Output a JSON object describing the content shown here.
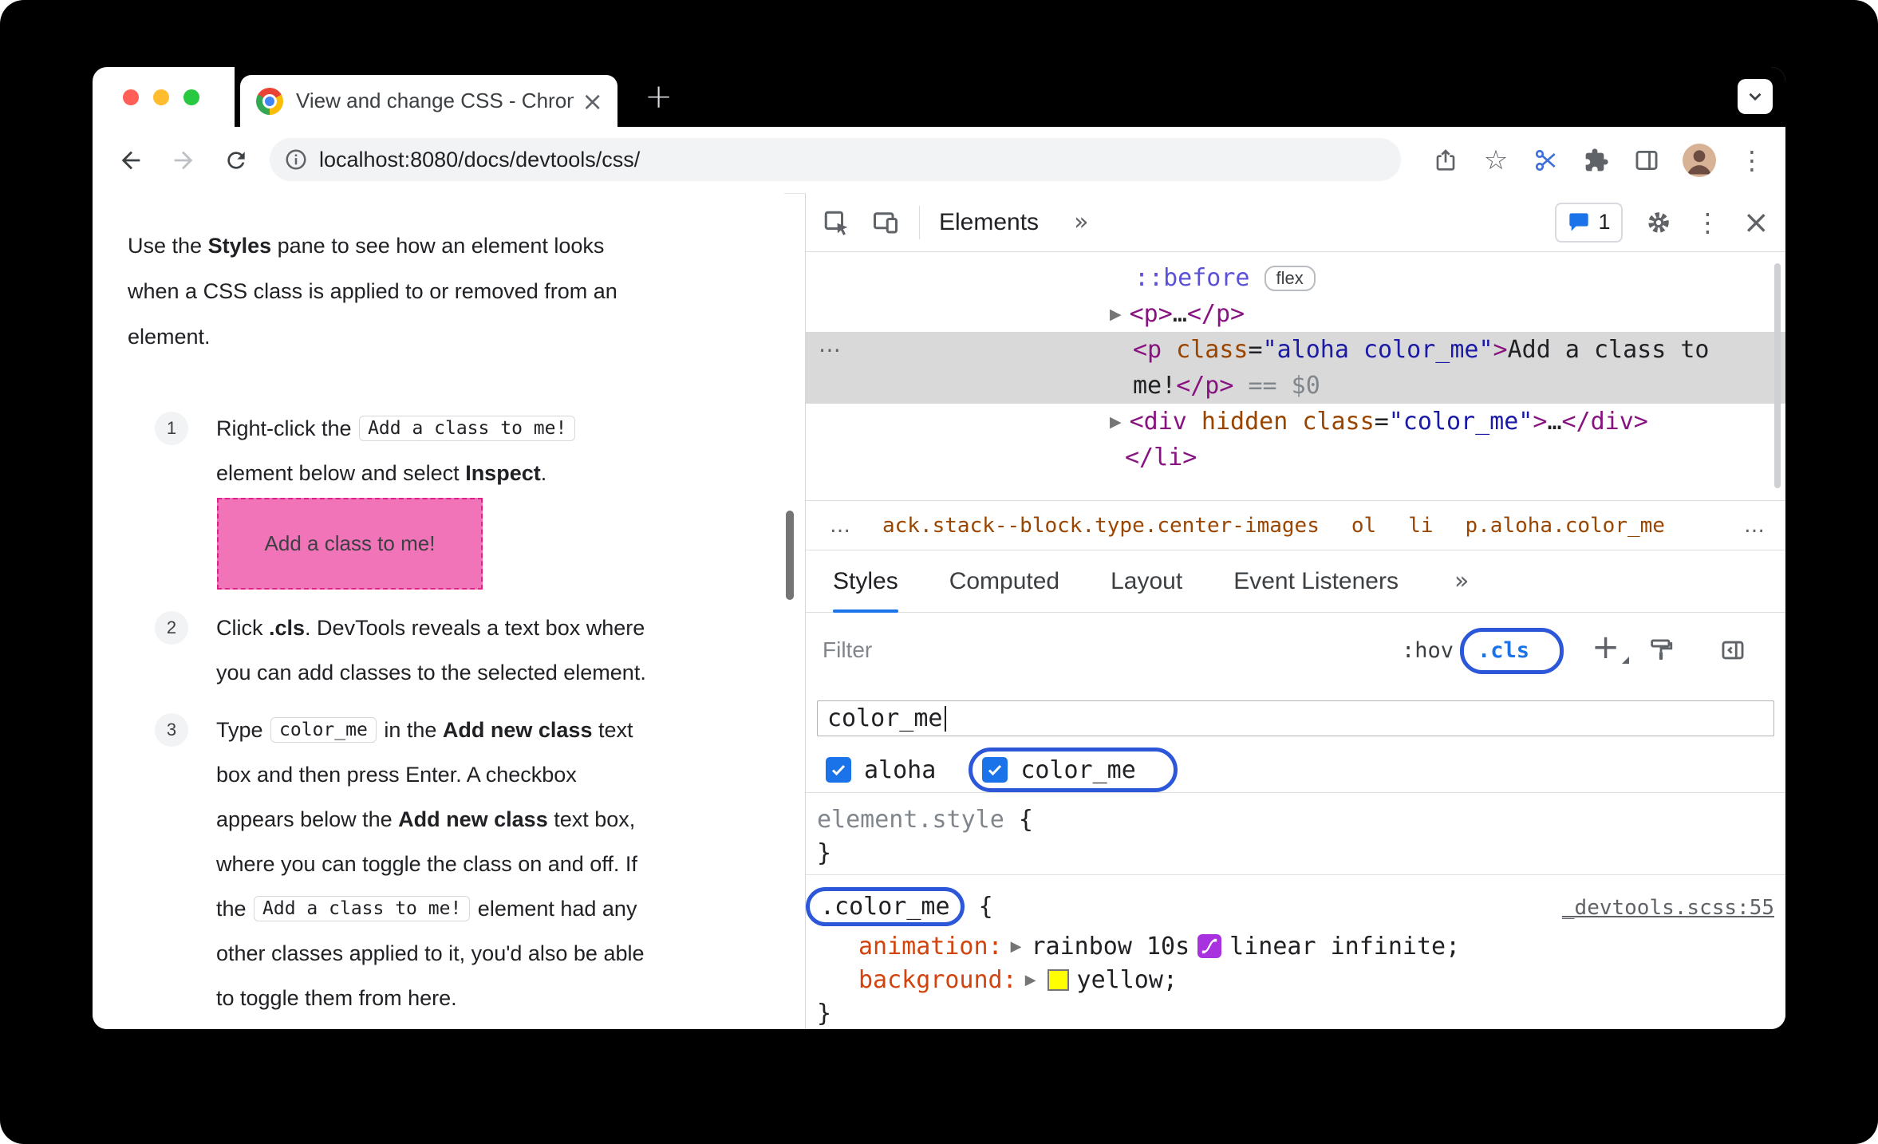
{
  "icons": {
    "star": "☆",
    "overflow": "⋮",
    "close": "×",
    "tab_close": "×",
    "new_tab": "+",
    "more": "»",
    "dom_arrow": "▶",
    "row_menu": "⋯",
    "ellipsis": "…",
    "plus": "+"
  },
  "window": {
    "tab_title": "View and change CSS - Chrom",
    "url": "localhost:8080/docs/devtools/css/"
  },
  "doc": {
    "intro_lines": [
      [
        [
          "t",
          "Use the "
        ],
        [
          "b",
          "Styles"
        ],
        [
          "t",
          " pane to see how an element looks"
        ]
      ],
      [
        [
          "t",
          "when a CSS class is applied to or removed from an"
        ]
      ],
      [
        [
          "t",
          "element."
        ]
      ]
    ],
    "steps": [
      {
        "num": "1",
        "lines": [
          [
            [
              "t",
              "Right-click the "
            ],
            [
              "c",
              "Add a class to me!"
            ]
          ],
          [
            [
              "t",
              "element below and select "
            ],
            [
              "b",
              "Inspect"
            ],
            [
              "t",
              "."
            ]
          ]
        ]
      },
      {
        "num": "2",
        "lines": [
          [
            [
              "t",
              "Click "
            ],
            [
              "b",
              ".cls"
            ],
            [
              "t",
              ". DevTools reveals a text box where"
            ]
          ],
          [
            [
              "t",
              "you can add classes to the selected element."
            ]
          ]
        ]
      },
      {
        "num": "3",
        "lines": [
          [
            [
              "t",
              "Type "
            ],
            [
              "c",
              "color_me"
            ],
            [
              "t",
              " in the "
            ],
            [
              "b",
              "Add new class"
            ],
            [
              "t",
              " text"
            ]
          ],
          [
            [
              "t",
              "box and then press Enter. A checkbox"
            ]
          ],
          [
            [
              "t",
              "appears below the "
            ],
            [
              "b",
              "Add new class"
            ],
            [
              "t",
              " text box,"
            ]
          ],
          [
            [
              "t",
              "where you can toggle the class on and off. If"
            ]
          ],
          [
            [
              "t",
              "the "
            ],
            [
              "c",
              "Add a class to me!"
            ],
            [
              "t",
              " element had any"
            ]
          ],
          [
            [
              "t",
              "other classes applied to it, you'd also be able"
            ]
          ],
          [
            [
              "t",
              "to toggle them from here."
            ]
          ]
        ]
      }
    ],
    "demo_label": "Add a class to me!"
  },
  "devtools": {
    "panel_tab": "Elements",
    "message_count": "1",
    "dom": {
      "pseudo": "::before",
      "pseudo_badge": "flex",
      "p_collapsed": [
        [
          "tag",
          "<p>"
        ],
        [
          "text",
          "…"
        ],
        [
          "tag",
          "</p>"
        ]
      ],
      "selected_line1": [
        [
          "tag",
          "<p"
        ],
        [
          "attr",
          " class"
        ],
        [
          "eq",
          "="
        ],
        [
          "val",
          "\"aloha color_me\""
        ],
        [
          "tag",
          ">"
        ],
        [
          "text",
          "Add a class to"
        ]
      ],
      "selected_line2": [
        [
          "text",
          "me!"
        ],
        [
          "tag",
          "</p>"
        ],
        [
          "dim",
          " == $0"
        ]
      ],
      "div_row": [
        [
          "tag",
          "<div"
        ],
        [
          "attr",
          " hidden"
        ],
        [
          "attr",
          " class"
        ],
        [
          "eq",
          "="
        ],
        [
          "val",
          "\"color_me\""
        ],
        [
          "tag",
          ">"
        ],
        [
          "text",
          "…"
        ],
        [
          "tag",
          "</div>"
        ]
      ],
      "li_close": [
        [
          "tag",
          "</li>"
        ]
      ]
    },
    "crumbs": {
      "items": [
        "ack.stack--block.type.center-images",
        "ol",
        "li",
        "p.aloha.color_me"
      ]
    },
    "tabs": [
      "Styles",
      "Computed",
      "Layout",
      "Event Listeners"
    ],
    "filter_placeholder": "Filter",
    "state_toggle": ":hov",
    "class_toggle": ".cls",
    "class_input_value": "color_me",
    "classes": [
      {
        "label": "aloha",
        "checked": true
      },
      {
        "label": "color_me",
        "checked": true
      }
    ],
    "styles": {
      "element_style": "element.style",
      "open_brace": "{",
      "close_brace": "}",
      "selector": ".color_me",
      "source_link": "_devtools.scss:55",
      "prop_animation": {
        "name": "animation:",
        "value_a": "rainbow 10s",
        "value_b": "linear infinite;"
      },
      "prop_background": {
        "name": "background:",
        "value": "yellow;",
        "swatch_color": "#ffff00"
      }
    }
  },
  "colors": {
    "annotation_blue": "#2b57d8",
    "accent_blue": "#1a73e8",
    "selected_row_bg": "#d9d9d9",
    "demo_bg": "#f274b8",
    "demo_border": "#e0218a",
    "tag": "#881280",
    "attr_name": "#994500",
    "attr_value": "#1a1aa6",
    "property_name": "#d2430d"
  }
}
